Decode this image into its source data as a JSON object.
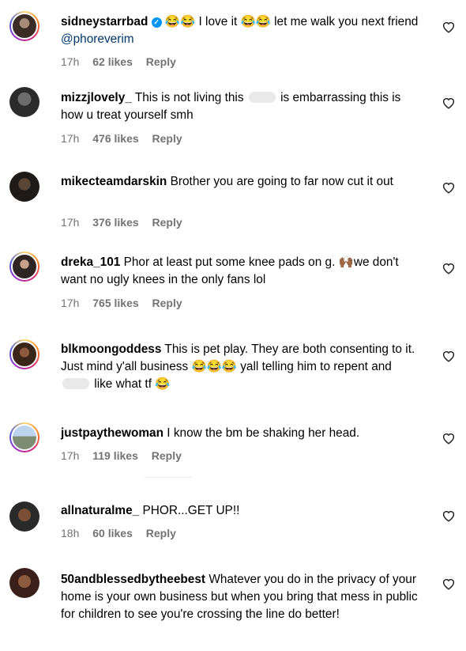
{
  "comments": [
    {
      "username": "sidneystarrbad",
      "verified": true,
      "text_pre": " 😂😂 I love it 😂😂 let me walk you next friend ",
      "mention": "@phoreverim",
      "time": "17h",
      "likes": "62 likes",
      "reply": "Reply"
    },
    {
      "username": "mizzjlovely_",
      "text_pre": " This is not living this ",
      "text_post": " is embarrassing this is how u treat yourself smh",
      "time": "17h",
      "likes": "476 likes",
      "reply": "Reply"
    },
    {
      "username": "mikecteamdarskin",
      "text_pre": " Brother you are going to far now cut it out",
      "time": "17h",
      "likes": "376 likes",
      "reply": "Reply"
    },
    {
      "username": "dreka_101",
      "text_pre": " Phor at least put some knee pads on g. 🙌🏾we don't want no ugly knees in the only fans lol",
      "time": "17h",
      "likes": "765 likes",
      "reply": "Reply"
    },
    {
      "username": "blkmoongoddess",
      "text_pre": " This is pet play. They are both consenting to it. Just mind y'all business 😂😂😂 yall telling him to repent and ",
      "text_post": " like what tf 😂",
      "time": "",
      "likes": "",
      "reply": ""
    },
    {
      "username": "justpaythewoman",
      "text_pre": " I know the bm be shaking her head.",
      "time": "17h",
      "likes": "119 likes",
      "reply": "Reply"
    },
    {
      "username": "allnaturalme_",
      "text_pre": " PHOR...GET UP!!",
      "time": "18h",
      "likes": "60 likes",
      "reply": "Reply"
    },
    {
      "username": "50andblessedbytheebest",
      "text_pre": " Whatever you do in the privacy of your home is your own business but when you bring that mess in public for children to see you're crossing the line do better!",
      "time": "",
      "likes": "",
      "reply": ""
    }
  ],
  "icons": {
    "like": "heart-outline-icon",
    "verified": "verified-badge-icon"
  }
}
